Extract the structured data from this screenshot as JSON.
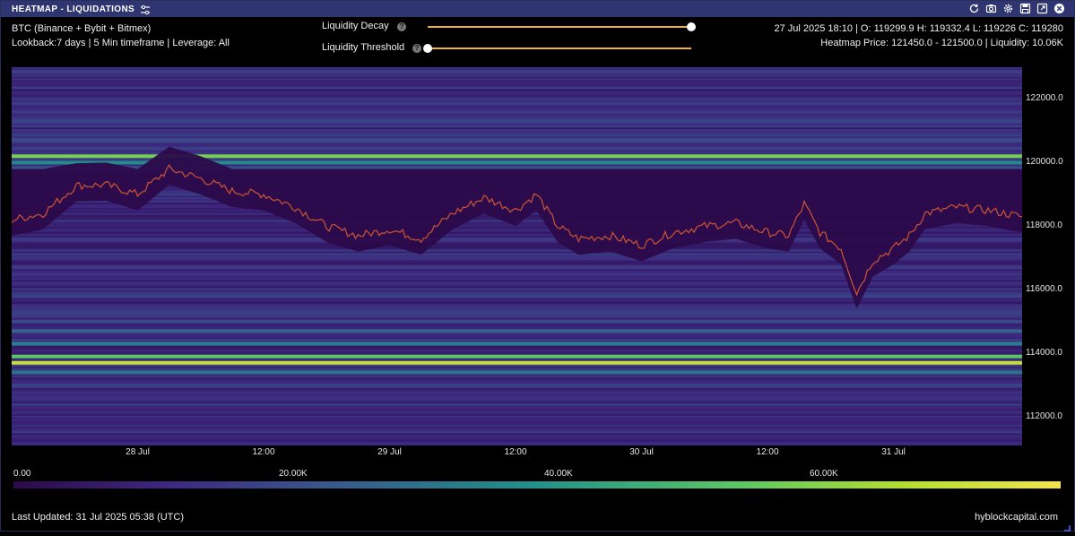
{
  "window": {
    "title": "HEATMAP - LIQUIDATIONS",
    "icons": [
      "settings-sliders-icon",
      "refresh-icon",
      "camera-icon",
      "gear-icon",
      "save-icon",
      "expand-icon",
      "close-icon"
    ]
  },
  "header": {
    "source": "BTC (Binance + Bybit + Bitmex)",
    "params": "Lookback:7 days | 5 Min timeframe | Leverage: All",
    "ohlc": "27 Jul 2025 18:10 | O: 119299.9 H: 119332.4 L: 119226 C: 119280",
    "heatmap_info": "Heatmap Price: 121450.0 - 121500.0 | Liquidity: 10.06K"
  },
  "controls": {
    "decay_label": "Liquidity Decay",
    "decay_value": 1.0,
    "threshold_label": "Liquidity Threshold",
    "threshold_value": 0.0,
    "help": "?"
  },
  "colors": {
    "background": "#000000",
    "titlebar": "#2e3570",
    "slider": "#f2b33a",
    "candle_up": "#2e9e55",
    "candle_down": "#e0402f",
    "heat_low": "#2b0a4a",
    "heat_high": "#f4e54a"
  },
  "chart_data": {
    "type": "heatmap",
    "title": "",
    "y_unit": "USD",
    "ylim": [
      111100,
      123000
    ],
    "xlim": [
      "2025-07-27T12:00",
      "2025-07-31T12:15"
    ],
    "y_ticks": [
      {
        "value": 112000,
        "label": "112000.0"
      },
      {
        "value": 114000,
        "label": "114000.0"
      },
      {
        "value": 116000,
        "label": "116000.0"
      },
      {
        "value": 118000,
        "label": "118000.0"
      },
      {
        "value": 120000,
        "label": "120000.0"
      },
      {
        "value": 122000,
        "label": "122000.0"
      }
    ],
    "x_ticks": [
      {
        "time": "2025-07-28T00:00",
        "label": "28 Jul"
      },
      {
        "time": "2025-07-28T12:00",
        "label": "12:00"
      },
      {
        "time": "2025-07-29T00:00",
        "label": "29 Jul"
      },
      {
        "time": "2025-07-29T12:00",
        "label": "12:00"
      },
      {
        "time": "2025-07-30T00:00",
        "label": "30 Jul"
      },
      {
        "time": "2025-07-30T12:00",
        "label": "12:00"
      },
      {
        "time": "2025-07-31T00:00",
        "label": "31 Jul"
      }
    ],
    "colorbar": {
      "min": 0,
      "max": 70000,
      "ticks": [
        {
          "value": 0,
          "label": "0.00"
        },
        {
          "value": 20000,
          "label": "20.00K"
        },
        {
          "value": 40000,
          "label": "40.00K"
        },
        {
          "value": 60000,
          "label": "60.00K"
        }
      ]
    },
    "liquidity_bands": [
      {
        "price": 122850,
        "value": 15000
      },
      {
        "price": 122450,
        "value": 9000
      },
      {
        "price": 122000,
        "value": 13000
      },
      {
        "price": 121700,
        "value": 10000
      },
      {
        "price": 121300,
        "value": 16000
      },
      {
        "price": 121000,
        "value": 12000
      },
      {
        "price": 120700,
        "value": 18000
      },
      {
        "price": 120200,
        "value": 52000
      },
      {
        "price": 120000,
        "value": 34000
      },
      {
        "price": 119800,
        "value": 20000
      },
      {
        "price": 117000,
        "value": 12000
      },
      {
        "price": 116700,
        "value": 14000
      },
      {
        "price": 116400,
        "value": 10000
      },
      {
        "price": 115800,
        "value": 16000
      },
      {
        "price": 115400,
        "value": 13000
      },
      {
        "price": 115000,
        "value": 18000
      },
      {
        "price": 114700,
        "value": 24000
      },
      {
        "price": 114300,
        "value": 30000
      },
      {
        "price": 113900,
        "value": 48000
      },
      {
        "price": 113700,
        "value": 62000
      },
      {
        "price": 113400,
        "value": 28000
      },
      {
        "price": 113000,
        "value": 16000
      },
      {
        "price": 112600,
        "value": 12000
      },
      {
        "price": 112300,
        "value": 10000
      },
      {
        "price": 111800,
        "value": 8000
      }
    ],
    "price_series": [
      {
        "t": "2025-07-27T12:00",
        "p": 118200
      },
      {
        "t": "2025-07-27T15:00",
        "p": 118400
      },
      {
        "t": "2025-07-27T18:10",
        "p": 119280
      },
      {
        "t": "2025-07-27T21:00",
        "p": 119300
      },
      {
        "t": "2025-07-28T00:00",
        "p": 119000
      },
      {
        "t": "2025-07-28T03:00",
        "p": 119800
      },
      {
        "t": "2025-07-28T06:00",
        "p": 119500
      },
      {
        "t": "2025-07-28T09:00",
        "p": 119100
      },
      {
        "t": "2025-07-28T12:00",
        "p": 119000
      },
      {
        "t": "2025-07-28T15:00",
        "p": 118600
      },
      {
        "t": "2025-07-28T18:00",
        "p": 118000
      },
      {
        "t": "2025-07-28T21:00",
        "p": 117700
      },
      {
        "t": "2025-07-29T00:00",
        "p": 117900
      },
      {
        "t": "2025-07-29T03:00",
        "p": 117600
      },
      {
        "t": "2025-07-29T06:00",
        "p": 118400
      },
      {
        "t": "2025-07-29T09:00",
        "p": 118900
      },
      {
        "t": "2025-07-29T12:00",
        "p": 118500
      },
      {
        "t": "2025-07-29T14:00",
        "p": 119000
      },
      {
        "t": "2025-07-29T16:00",
        "p": 118000
      },
      {
        "t": "2025-07-29T18:00",
        "p": 117600
      },
      {
        "t": "2025-07-29T21:00",
        "p": 117700
      },
      {
        "t": "2025-07-30T00:00",
        "p": 117400
      },
      {
        "t": "2025-07-30T03:00",
        "p": 117800
      },
      {
        "t": "2025-07-30T06:00",
        "p": 118000
      },
      {
        "t": "2025-07-30T09:00",
        "p": 118100
      },
      {
        "t": "2025-07-30T12:00",
        "p": 117800
      },
      {
        "t": "2025-07-30T14:00",
        "p": 117700
      },
      {
        "t": "2025-07-30T15:30",
        "p": 118700
      },
      {
        "t": "2025-07-30T17:00",
        "p": 117800
      },
      {
        "t": "2025-07-30T19:00",
        "p": 117300
      },
      {
        "t": "2025-07-30T20:30",
        "p": 115900
      },
      {
        "t": "2025-07-30T22:00",
        "p": 116900
      },
      {
        "t": "2025-07-31T00:00",
        "p": 117300
      },
      {
        "t": "2025-07-31T01:30",
        "p": 117700
      },
      {
        "t": "2025-07-31T03:00",
        "p": 118400
      },
      {
        "t": "2025-07-31T06:00",
        "p": 118600
      },
      {
        "t": "2025-07-31T09:00",
        "p": 118500
      },
      {
        "t": "2025-07-31T12:15",
        "p": 118300
      }
    ]
  },
  "footer": {
    "updated": "Last Updated: 31 Jul 2025 05:38 (UTC)",
    "brand": "hyblockcapital.com"
  }
}
